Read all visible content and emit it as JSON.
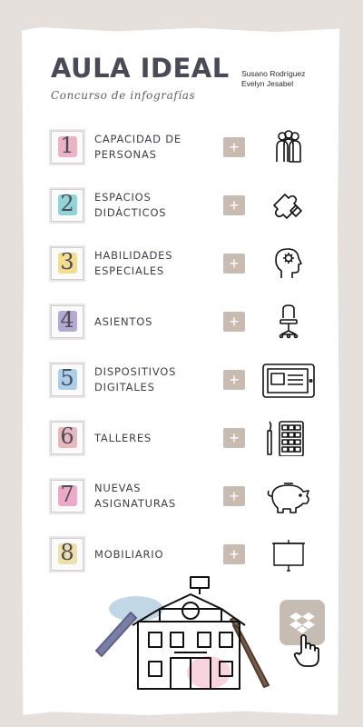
{
  "header": {
    "title": "AULA IDEAL",
    "subtitle": "Concurso de infografías",
    "authors": [
      "Susano Rodríguez",
      "Evelyn Jesabel"
    ]
  },
  "items": [
    {
      "number": "1",
      "label": "Capacidad de personas",
      "icon": "people-icon",
      "color": "#e79bb3"
    },
    {
      "number": "2",
      "label": "Espacios didácticos",
      "icon": "puzzle-icon",
      "color": "#6fc6cc"
    },
    {
      "number": "3",
      "label": "Habilidades especiales",
      "icon": "head-gear-icon",
      "color": "#f0d36a"
    },
    {
      "number": "4",
      "label": "Asientos",
      "icon": "chair-icon",
      "color": "#9b8fc4"
    },
    {
      "number": "5",
      "label": "Dispositivos digitales",
      "icon": "tablet-icon",
      "color": "#8fbfe6"
    },
    {
      "number": "6",
      "label": "Talleres",
      "icon": "paint-palette-icon",
      "color": "#e0a3a8"
    },
    {
      "number": "7",
      "label": "Nuevas asignaturas",
      "icon": "piggy-bank-icon",
      "color": "#e58fb6"
    },
    {
      "number": "8",
      "label": "Mobiliario",
      "icon": "projector-screen-icon",
      "color": "#e9d78e"
    }
  ],
  "plus_label": "+"
}
